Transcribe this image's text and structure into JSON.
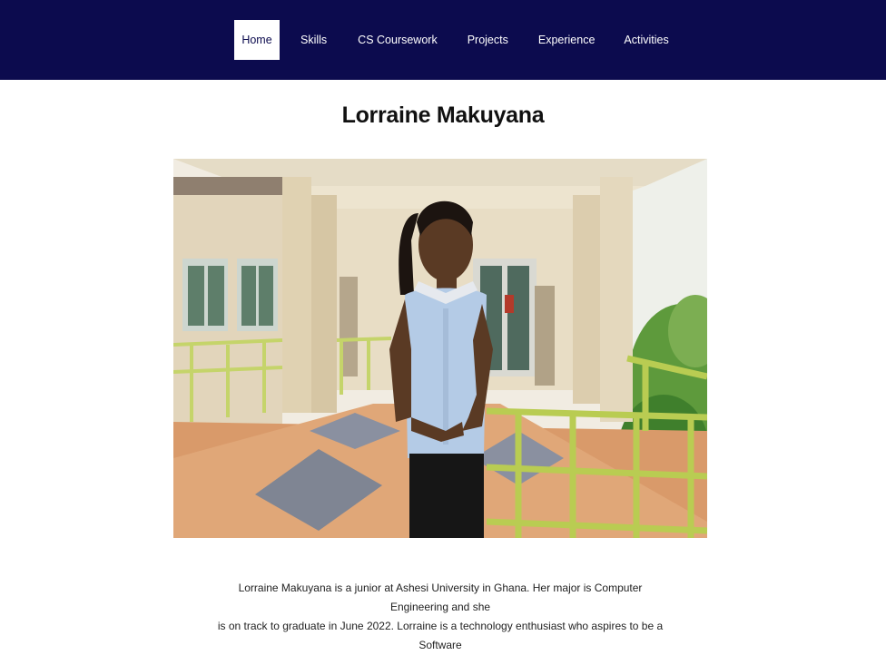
{
  "nav": {
    "items": [
      {
        "label": "Home",
        "active": true
      },
      {
        "label": "Skills",
        "active": false
      },
      {
        "label": "CS Coursework",
        "active": false
      },
      {
        "label": "Projects",
        "active": false
      },
      {
        "label": "Experience",
        "active": false
      },
      {
        "label": "Activities",
        "active": false
      }
    ],
    "bg_color": "#0c0b4e",
    "active_bg": "#ffffff"
  },
  "main": {
    "title": "Lorraine Makuyana",
    "bio_line1": "Lorraine Makuyana is a junior at Ashesi University in Ghana. Her major is Computer Engineering and she",
    "bio_line2": "is on track to graduate in June 2022. Lorraine is a technology enthusiast who aspires to be a Software"
  }
}
